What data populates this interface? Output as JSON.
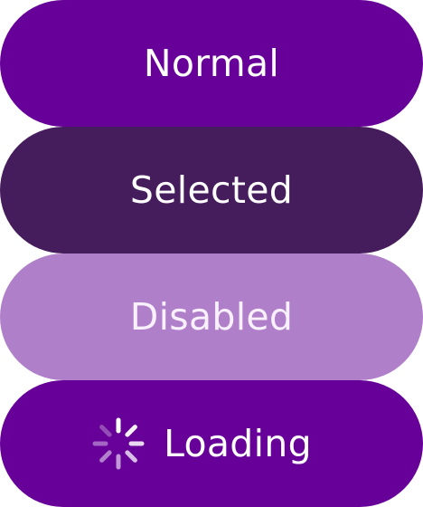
{
  "buttons": {
    "normal": {
      "label": "Normal",
      "color": "#660099"
    },
    "selected": {
      "label": "Selected",
      "color": "#451c5c"
    },
    "disabled": {
      "label": "Disabled",
      "color": "#b07fc9"
    },
    "loading": {
      "label": "Loading",
      "color": "#660099",
      "icon": "spinner-icon"
    }
  }
}
